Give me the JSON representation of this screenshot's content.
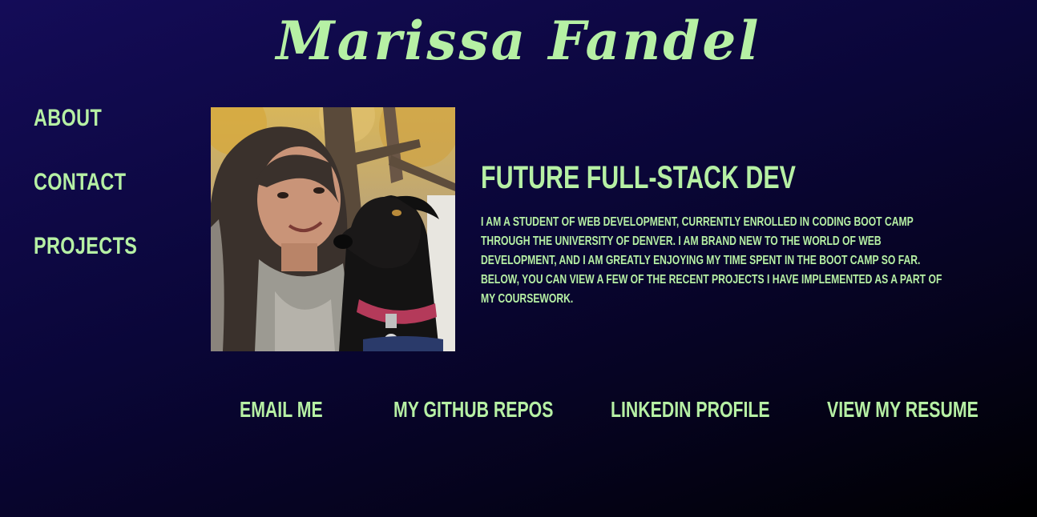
{
  "header": {
    "title": "Marissa Fandel"
  },
  "nav": {
    "items": [
      {
        "label": "ABOUT"
      },
      {
        "label": "CONTACT"
      },
      {
        "label": "PROJECTS"
      }
    ]
  },
  "profile": {
    "photo_alt": "Photo of Marissa with her dog"
  },
  "intro": {
    "headline": "FUTURE FULL-STACK DEV",
    "bio": "I am a student of web development, currently enrolled in coding boot camp through the University of Denver. I am brand new to the world of web development, and I am greatly enjoying my time spent in the boot camp so far. Below, you can view a few of the recent projects I have implemented as a part of my coursework."
  },
  "links": {
    "email": "EMAIL ME",
    "github": "MY GITHUB REPOS",
    "linkedin": "LINKEDIN PROFILE",
    "resume": "VIEW MY RESUME"
  },
  "colors": {
    "accent": "#b6f0a4",
    "background_top": "#140c58",
    "background_bottom": "#000000"
  }
}
